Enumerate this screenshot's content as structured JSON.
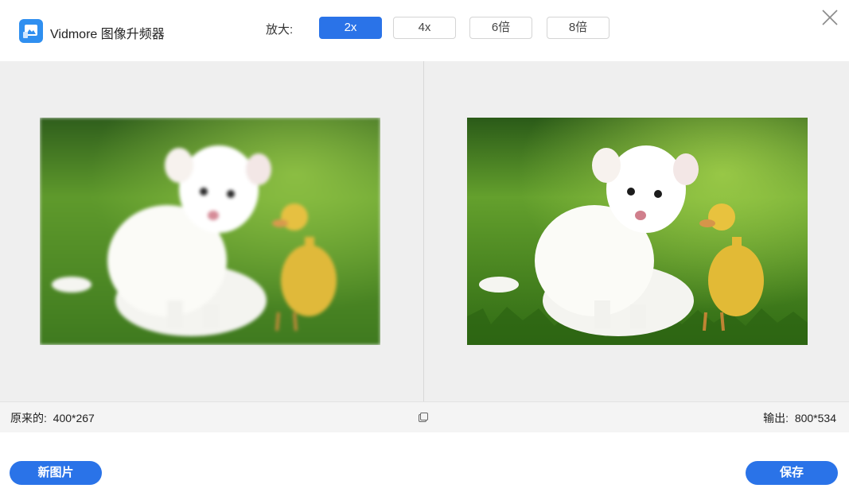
{
  "header": {
    "app_title": "Vidmore 图像升频器",
    "logo_icon": "image-upscale-logo-icon",
    "zoom_label": "放大:",
    "zoom_options": [
      "2x",
      "4x",
      "6倍",
      "8倍"
    ],
    "selected_zoom": "2x",
    "close_icon": "close-icon"
  },
  "viewer": {
    "left_image": "blurry white puppy and yellow duckling on grass",
    "right_image": "sharpened white puppy and yellow duckling on grass"
  },
  "infobar": {
    "original_label": "原来的:",
    "original_size": "400*267",
    "output_label": "输出:",
    "output_size": "800*534",
    "compare_icon": "square-icon"
  },
  "actions": {
    "new_image": "新图片",
    "save": "保存"
  },
  "colors": {
    "accent": "#2a73e8",
    "viewer_bg": "#efefef",
    "infobar_bg": "#f4f4f4"
  }
}
